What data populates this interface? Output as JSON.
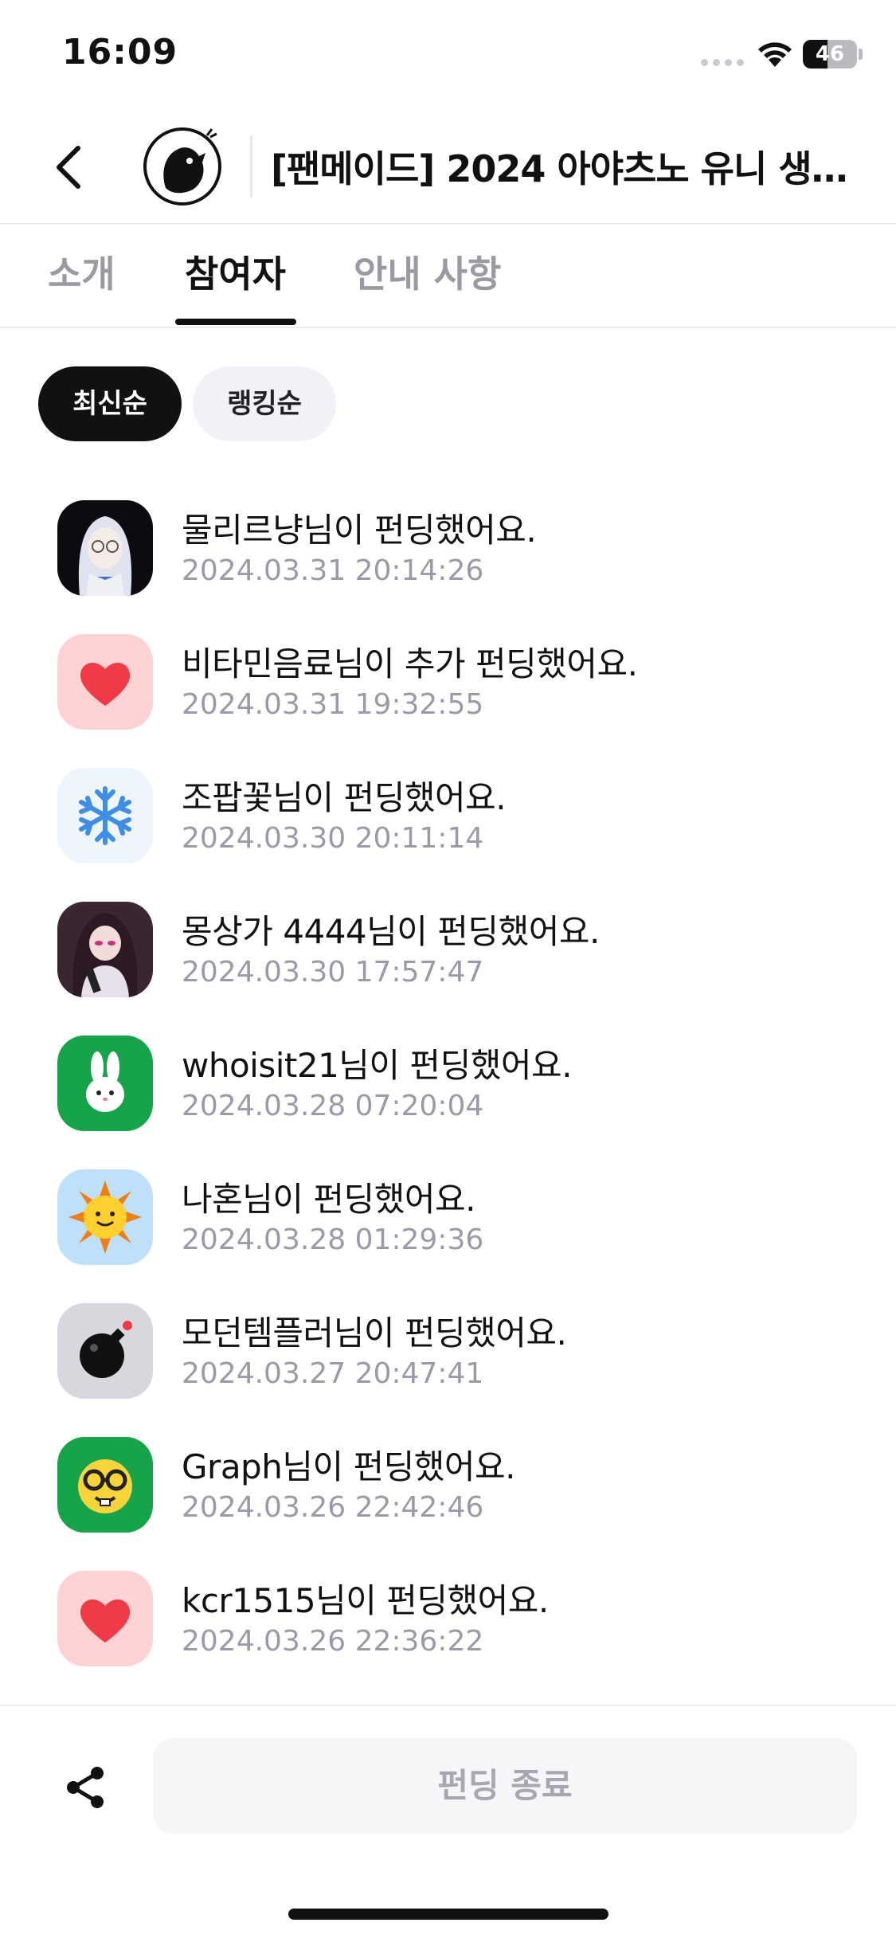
{
  "status_bar": {
    "time": "16:09",
    "battery": "46",
    "battery_level": 0.46
  },
  "header": {
    "title": "[팬메이드] 2024 아야츠노 유니 생일…"
  },
  "tabs": [
    {
      "label": "소개"
    },
    {
      "label": "참여자"
    },
    {
      "label": "안내 사항"
    }
  ],
  "filters": {
    "latest": "최신순",
    "ranking": "랭킹순"
  },
  "participants": [
    {
      "text": "물리르냥님이 펀딩했어요.",
      "date": "2024.03.31 20:14:26",
      "avatar": "anime-girl-avatar"
    },
    {
      "text": "비타민음료님이 추가 펀딩했어요.",
      "date": "2024.03.31 19:32:55",
      "avatar": "heart-icon"
    },
    {
      "text": "조팝꽃님이 펀딩했어요.",
      "date": "2024.03.30 20:11:14",
      "avatar": "snowflake-icon"
    },
    {
      "text": "몽상가 4444님이 펀딩했어요.",
      "date": "2024.03.30 17:57:47",
      "avatar": "anime-character-avatar"
    },
    {
      "text": "whoisit21님이 펀딩했어요.",
      "date": "2024.03.28 07:20:04",
      "avatar": "bunny-icon"
    },
    {
      "text": "나혼님이 펀딩했어요.",
      "date": "2024.03.28 01:29:36",
      "avatar": "sun-icon"
    },
    {
      "text": "모던템플러님이 펀딩했어요.",
      "date": "2024.03.27 20:47:41",
      "avatar": "bomb-icon"
    },
    {
      "text": "Graph님이 펀딩했어요.",
      "date": "2024.03.26 22:42:46",
      "avatar": "nerd-face-icon"
    },
    {
      "text": "kcr1515님이 펀딩했어요.",
      "date": "2024.03.26 22:36:22",
      "avatar": "heart-icon"
    }
  ],
  "bottom": {
    "end_button": "펀딩 종료"
  },
  "colors": {
    "accent": "#111111",
    "muted_text": "#9a9aa8",
    "heart_bg": "#fdd2d2",
    "heart": "#f03a45"
  }
}
